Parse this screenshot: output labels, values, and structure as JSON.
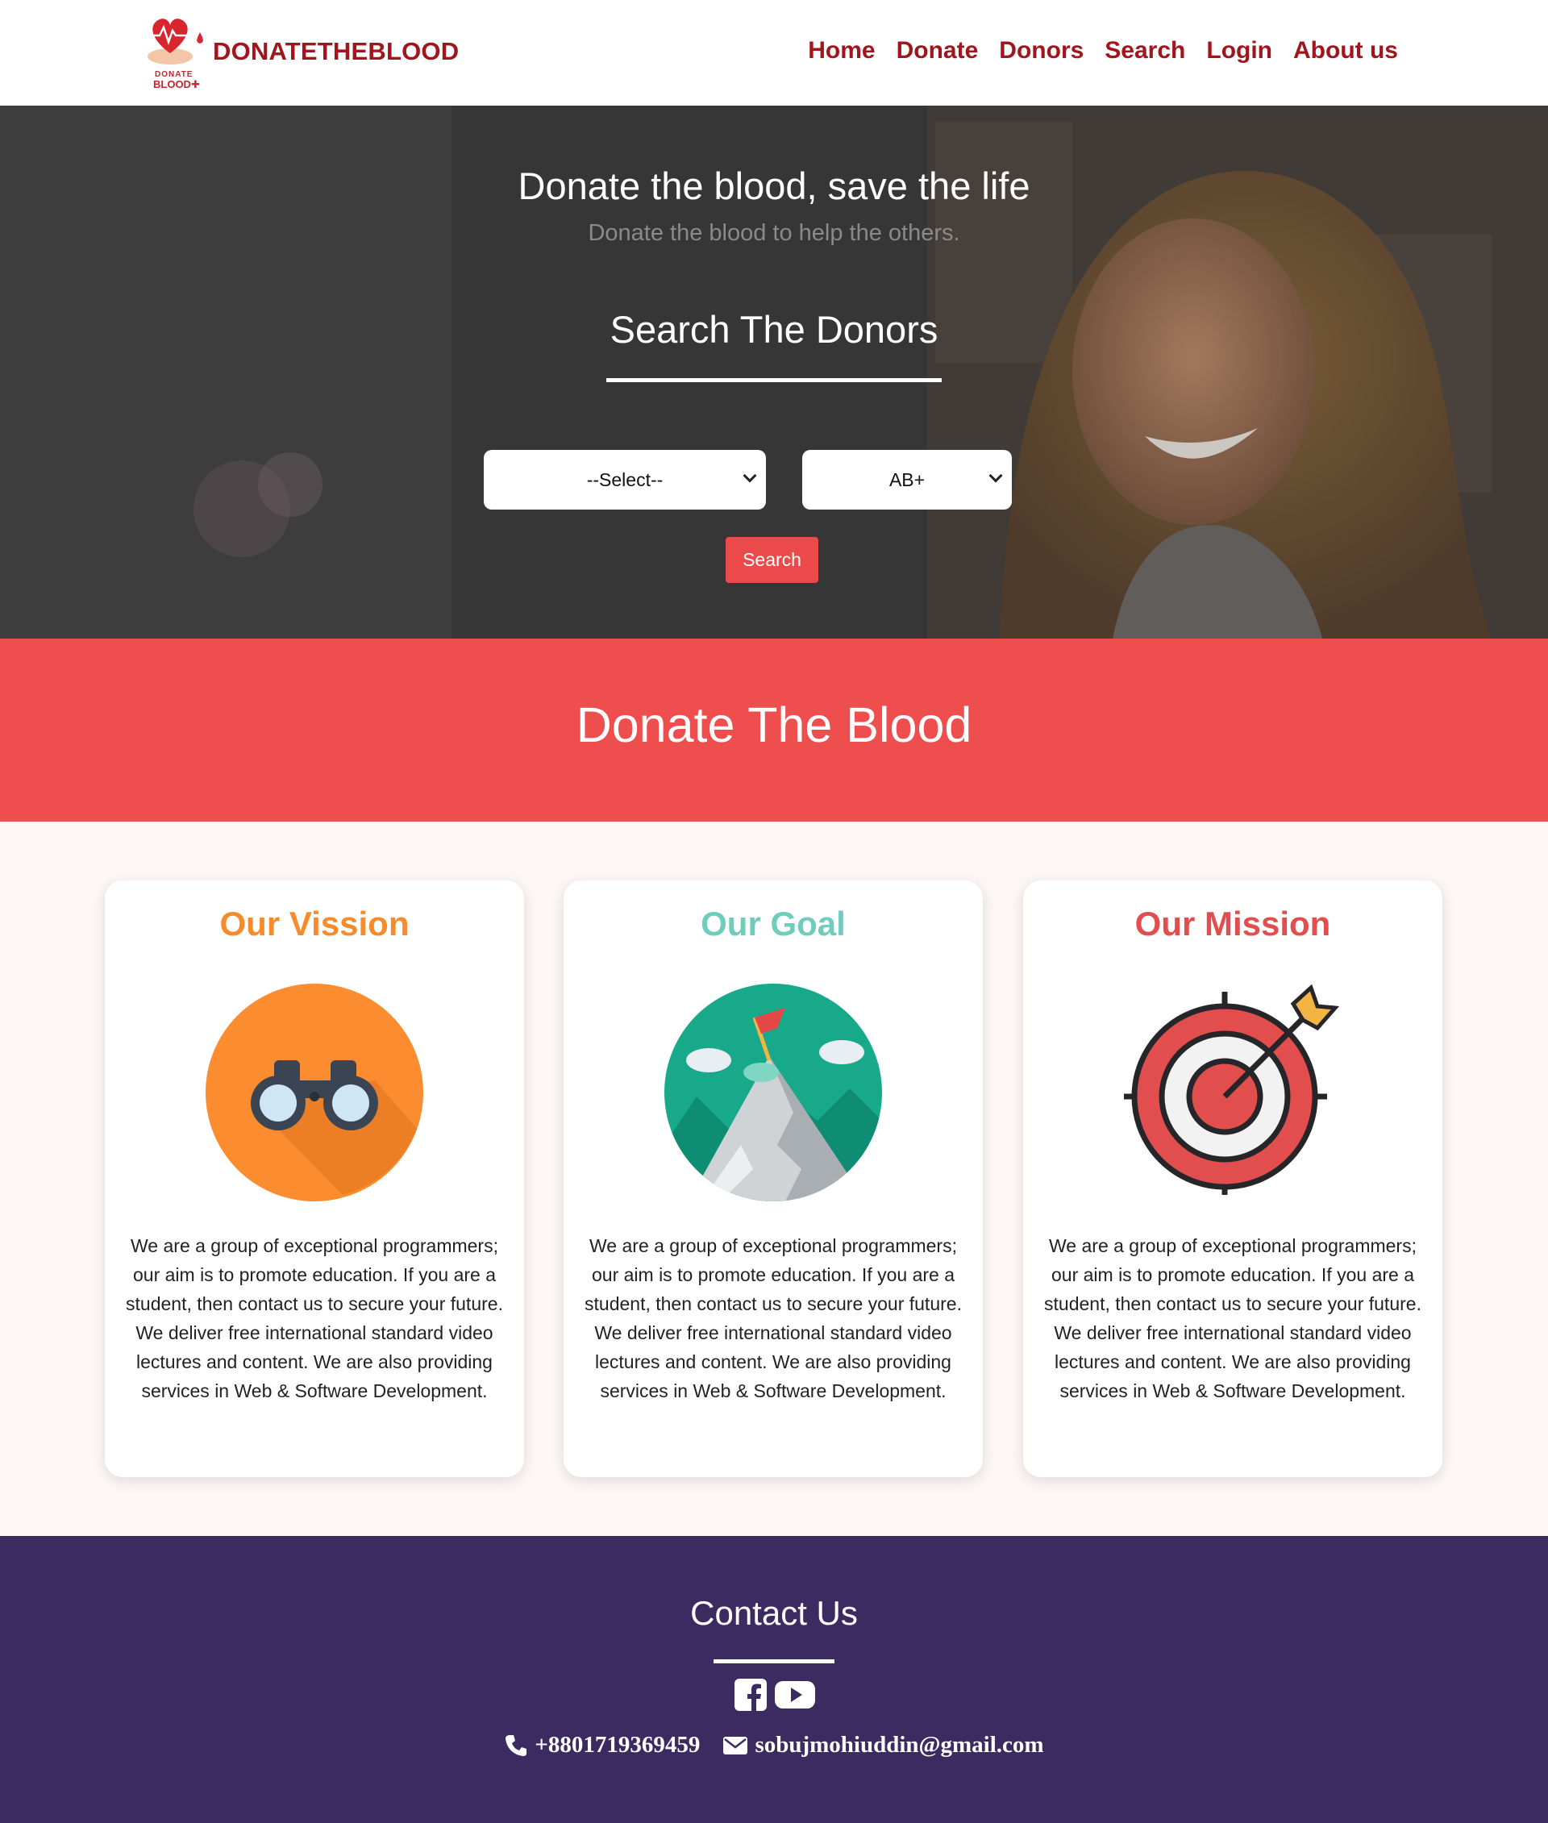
{
  "brand": {
    "name": "DONATETHEBLOOD",
    "logo_text_top": "DONATE",
    "logo_text_bottom": "BLOOD"
  },
  "nav": {
    "items": [
      {
        "label": "Home"
      },
      {
        "label": "Donate"
      },
      {
        "label": "Donors"
      },
      {
        "label": "Search"
      },
      {
        "label": "Login"
      },
      {
        "label": "About us"
      }
    ]
  },
  "hero": {
    "title": "Donate the blood, save the life",
    "subtitle": "Donate the blood to help the others.",
    "search_heading": "Search The Donors",
    "district_select": {
      "selected": "--Select--"
    },
    "blood_group_select": {
      "selected": "AB+"
    },
    "search_button": "Search"
  },
  "band": {
    "title": "Donate The Blood"
  },
  "cards": [
    {
      "title": "Our Vission",
      "color": "#f68b2c",
      "icon": "binoculars-icon",
      "text": "We are a group of exceptional programmers; our aim is to promote education. If you are a student, then contact us to secure your future. We deliver free international standard video lectures and content. We are also providing services in Web & Software Development."
    },
    {
      "title": "Our Goal",
      "color": "#6fcdbd",
      "icon": "mountain-flag-icon",
      "text": "We are a group of exceptional programmers; our aim is to promote education. If you are a student, then contact us to secure your future. We deliver free international standard video lectures and content. We are also providing services in Web & Software Development."
    },
    {
      "title": "Our Mission",
      "color": "#e24d4d",
      "icon": "target-icon",
      "text": "We are a group of exceptional programmers; our aim is to promote education. If you are a student, then contact us to secure your future. We deliver free international standard video lectures and content. We are also providing services in Web & Software Development."
    }
  ],
  "footer": {
    "title": "Contact Us",
    "phone": "+8801719369459",
    "email": "sobujmohiuddin@gmail.com",
    "social": [
      "facebook-icon",
      "youtube-icon"
    ]
  },
  "colors": {
    "brand_red": "#a1151c",
    "band_red": "#ef4e4e",
    "button_red": "#ea4a4a",
    "footer_purple": "#3c2b61"
  }
}
